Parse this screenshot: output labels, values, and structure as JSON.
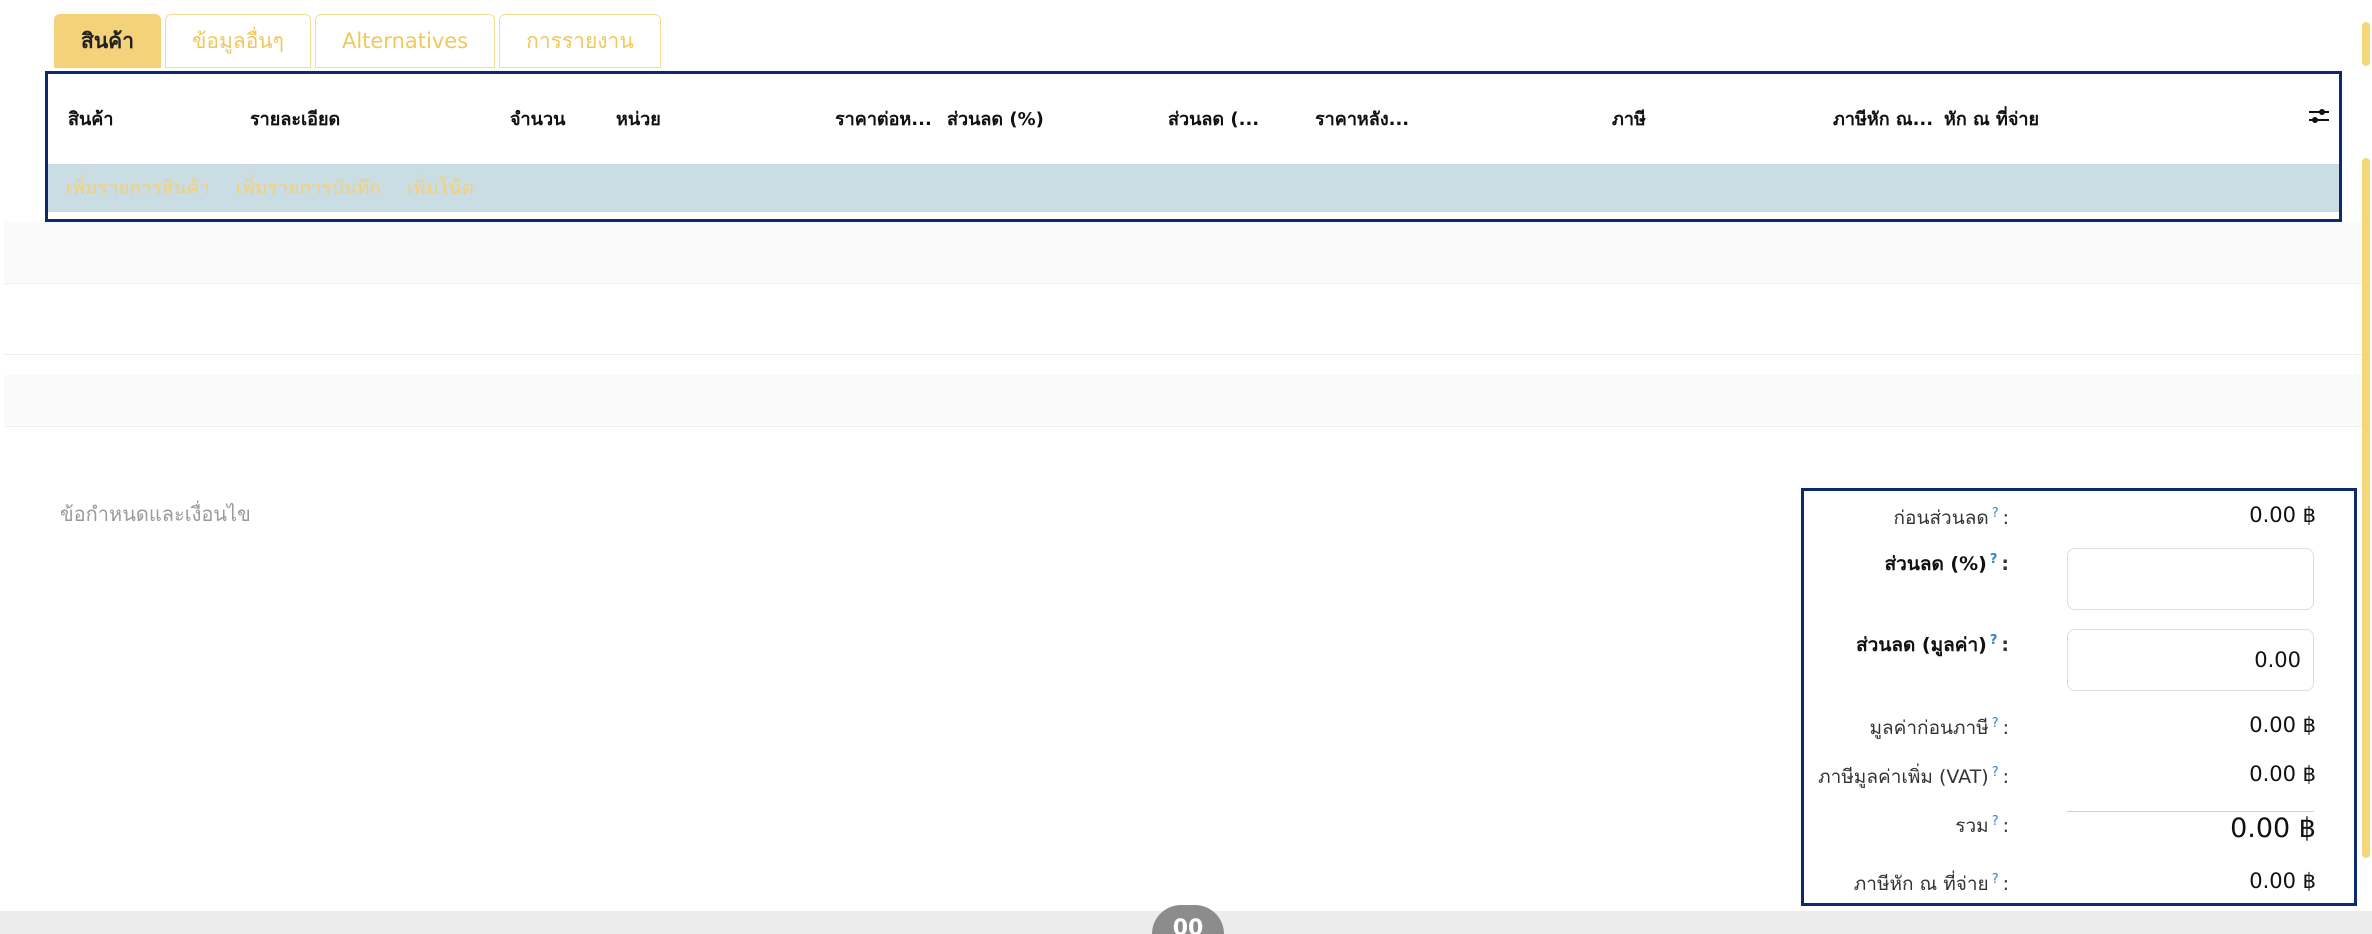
{
  "tabs": [
    {
      "label": "สินค้า",
      "active": true
    },
    {
      "label": "ข้อมูลอื่นๆ",
      "active": false
    },
    {
      "label": "Alternatives",
      "active": false
    },
    {
      "label": "การรายงาน",
      "active": false
    }
  ],
  "table": {
    "columns": [
      "สินค้า",
      "รายละเอียด",
      "จำนวน",
      "หน่วย",
      "ราคาต่อห...",
      "ส่วนลด (%)",
      "ส่วนลด (...",
      "ราคาหลัง...",
      "ภาษี",
      "ภาษีหัก ณ...",
      "หัก ณ ที่จ่าย"
    ],
    "optional_columns_icon": "sliders-icon",
    "add_links": [
      "เพิ่มรายการสินค้า",
      "เพิ่มรายการบันทึก",
      "เพิ่มโน้ต"
    ]
  },
  "terms": {
    "placeholder": "ข้อกำหนดและเงื่อนไข"
  },
  "totals": {
    "before_discount": {
      "label": "ก่อนส่วนลด",
      "value": "0.00 ฿"
    },
    "discount_percent": {
      "label": "ส่วนลด (%)",
      "value": ""
    },
    "discount_amount": {
      "label": "ส่วนลด (มูลค่า)",
      "value": "0.00"
    },
    "untaxed": {
      "label": "มูลค่าก่อนภาษี",
      "value": "0.00 ฿"
    },
    "vat": {
      "label": "ภาษีมูลค่าเพิ่ม (VAT)",
      "value": "0.00 ฿"
    },
    "total": {
      "label": "รวม",
      "value": "0.00 ฿"
    },
    "withholding": {
      "label": "ภาษีหัก ณ ที่จ่าย",
      "value": "0.00 ฿"
    },
    "help_mark": "?",
    "colon": ":"
  },
  "bubble": {
    "text": "00"
  },
  "colors": {
    "accent": "#f4d27a",
    "accent_text": "#efc95a",
    "highlight_border": "#0d2a6b",
    "add_row_bg": "#cadde4",
    "help_mark": "#3b7fc4"
  }
}
